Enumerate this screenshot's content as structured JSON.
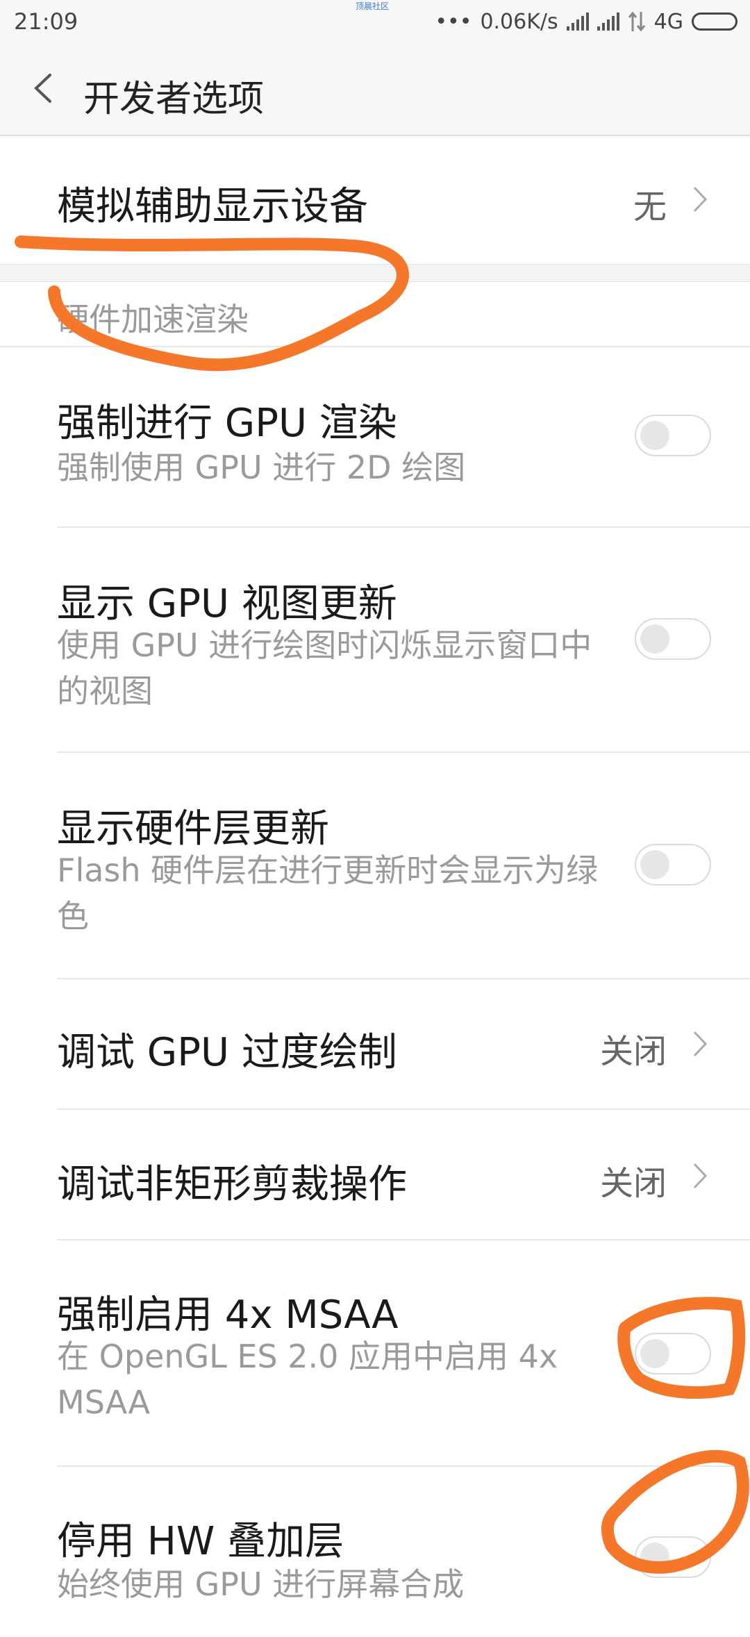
{
  "status_bar": {
    "time": "21:09",
    "watermark": "顶晨社区",
    "dots": "•••",
    "speed": "0.06K/s",
    "network": "4G"
  },
  "app_bar": {
    "title": "开发者选项",
    "back_icon": "back-arrow-icon"
  },
  "rows": {
    "simulate_display": {
      "label": "模拟辅助显示设备",
      "value": "无"
    },
    "section_hw": {
      "label": "硬件加速渲染"
    },
    "force_gpu": {
      "label": "强制进行 GPU 渲染",
      "desc": "强制使用 GPU 进行 2D 绘图",
      "on": false
    },
    "show_gpu_updates": {
      "label": "显示 GPU 视图更新",
      "desc": "使用 GPU 进行绘图时闪烁显示窗口中的视图",
      "on": false
    },
    "show_hw_layers": {
      "label": "显示硬件层更新",
      "desc": "Flash 硬件层在进行更新时会显示为绿色",
      "on": false
    },
    "debug_overdraw": {
      "label": "调试 GPU 过度绘制",
      "value": "关闭"
    },
    "debug_nonrect_clip": {
      "label": "调试非矩形剪裁操作",
      "value": "关闭"
    },
    "force_msaa": {
      "label": "强制启用 4x MSAA",
      "desc": "在 OpenGL ES 2.0 应用中启用 4x MSAA",
      "on": false
    },
    "disable_hw_overlays": {
      "label": "停用 HW 叠加层",
      "desc": "始终使用 GPU 进行屏幕合成",
      "on": false
    }
  },
  "annotation_color": "#f5772a"
}
